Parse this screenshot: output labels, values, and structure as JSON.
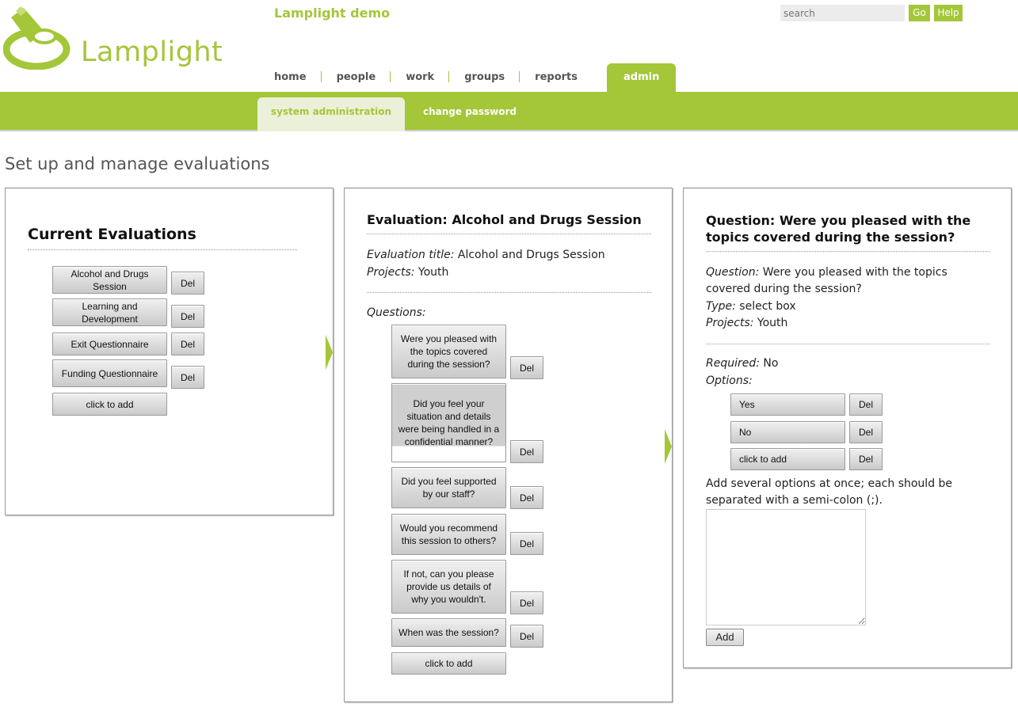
{
  "app": {
    "title": "Lamplight demo",
    "logo_text": "Lamplight"
  },
  "search": {
    "placeholder": "search",
    "go_label": "Go",
    "help_label": "Help"
  },
  "nav": {
    "home": "home",
    "people": "people",
    "work": "work",
    "groups": "groups",
    "reports": "reports",
    "admin": "admin"
  },
  "subnav": {
    "system_admin": "system administration",
    "change_password": "change password"
  },
  "page_title": "Set up and manage evaluations",
  "evaluations_panel": {
    "heading": "Current Evaluations",
    "items": [
      "Alcohol and Drugs Session",
      "Learning and Development",
      "Exit Questionnaire",
      "Funding Questionnaire"
    ],
    "add_label": "click to add",
    "del_label": "Del"
  },
  "evaluation_panel": {
    "heading": "Evaluation: Alcohol and Drugs Session",
    "title_label": "Evaluation title:",
    "title_value": "Alcohol and Drugs Session",
    "projects_label": "Projects:",
    "projects_value": "Youth",
    "questions_label": "Questions:",
    "questions": [
      "Were you pleased with the topics covered during the session?",
      "Did you feel your situation and details were being handled in a confidential manner?",
      "Did you feel supported by our staff?",
      "Would you recommend this session to others?",
      "If not, can you please provide us details of why you wouldn't.",
      "When was the session?"
    ],
    "add_label": "click to add",
    "del_label": "Del"
  },
  "question_panel": {
    "heading": "Question: Were you pleased with the topics covered during the session?",
    "question_label": "Question:",
    "question_value": "Were you pleased with the topics covered during the session?",
    "type_label": "Type:",
    "type_value": "select box",
    "projects_label": "Projects:",
    "projects_value": "Youth",
    "required_label": "Required:",
    "required_value": "No",
    "options_label": "Options:",
    "options": [
      "Yes",
      "No"
    ],
    "add_label": "click to add",
    "del_label": "Del",
    "bulk_hint": "Add several options at once; each should be separated with a semi-colon (;).",
    "add_button": "Add"
  },
  "colors": {
    "brand": "#a4c639",
    "subtab_bg": "#ebf1d8"
  }
}
